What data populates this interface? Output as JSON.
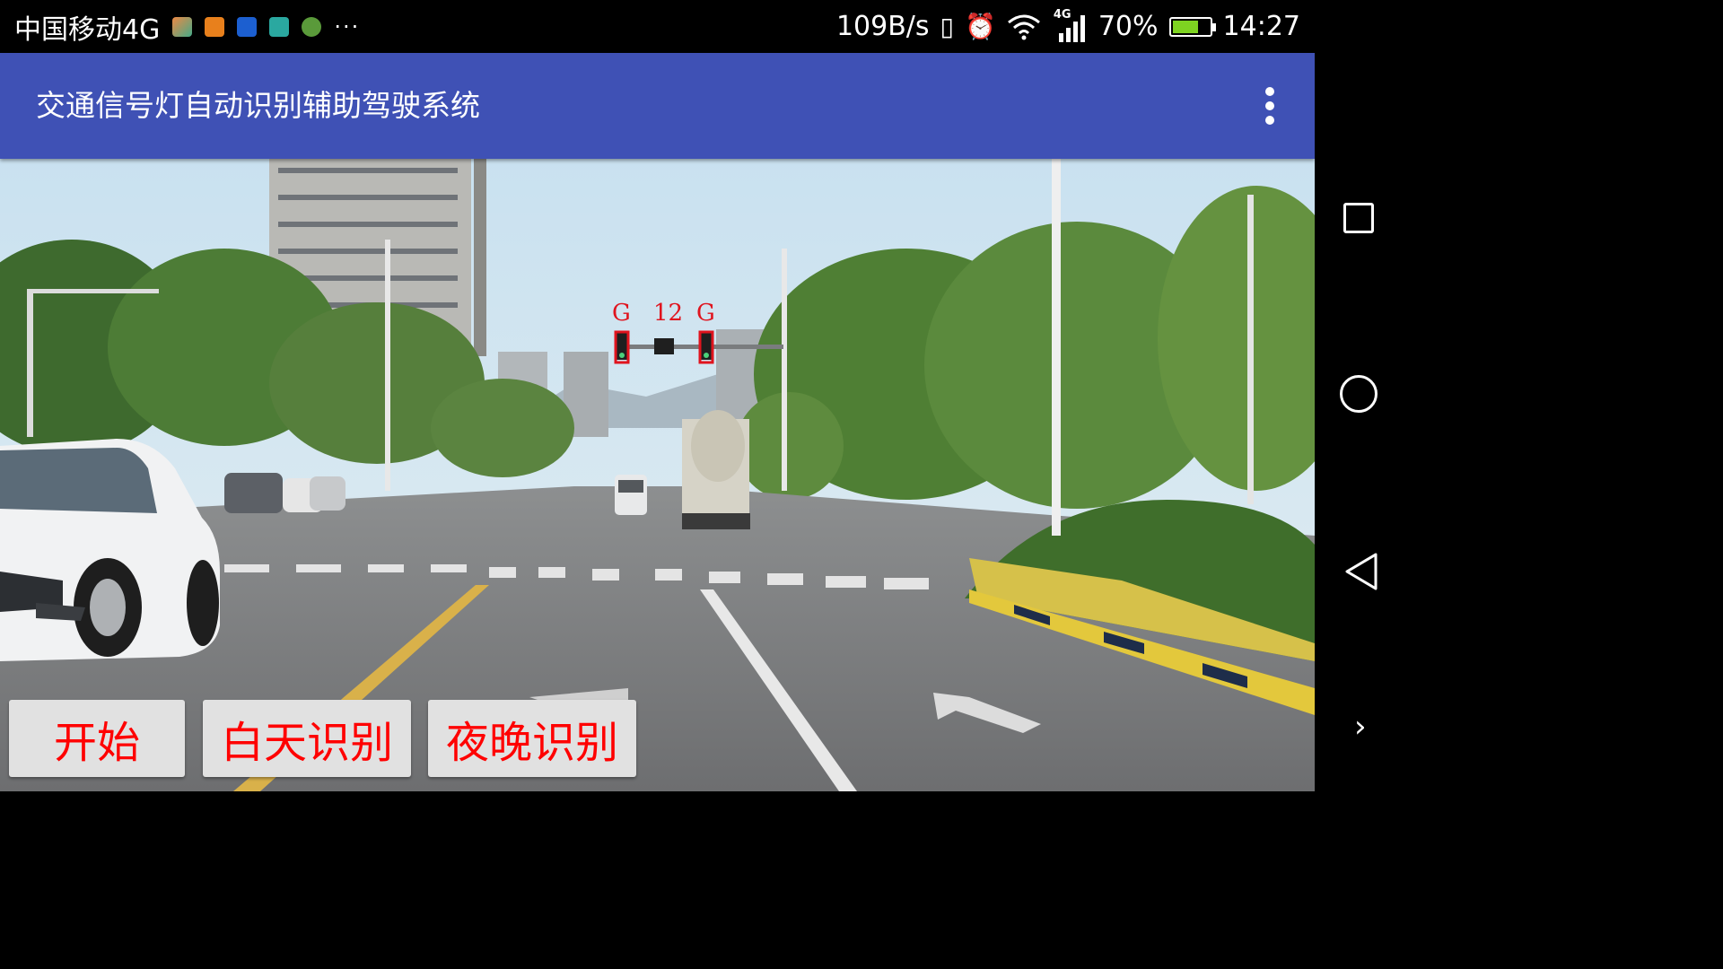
{
  "status_bar": {
    "carrier": "中国移动4G",
    "more": "···",
    "speed": "109B/s",
    "network": "4G",
    "battery": "70%",
    "battery_fraction": 0.7,
    "time": "14:27"
  },
  "app_bar": {
    "title": "交通信号灯自动识别辅助驾驶系统"
  },
  "detection": {
    "left_light": "G",
    "countdown": "12",
    "right_light": "G",
    "box_color": "#e0141e"
  },
  "buttons": {
    "start": "开始",
    "day": "白天识别",
    "night": "夜晚识别",
    "label_color": "#ff0000"
  },
  "colors": {
    "app_bar": "#3f51b5",
    "button_bg": "#e1e1e1"
  }
}
